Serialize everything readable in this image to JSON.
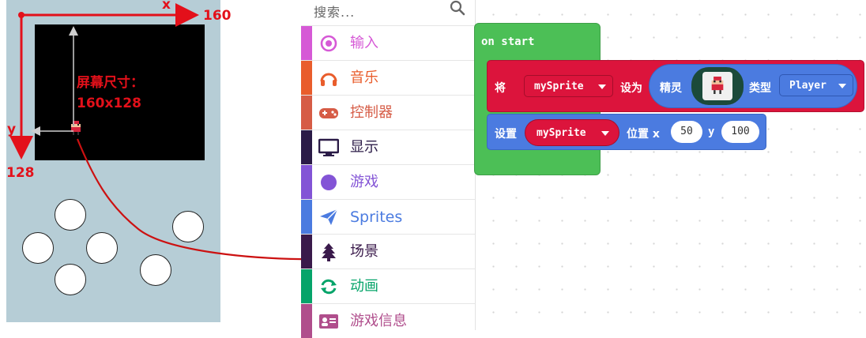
{
  "simulator": {
    "x_axis_label": "x",
    "x_axis_max": "160",
    "y_axis_label": "y",
    "y_axis_max": "128",
    "screen_note_title": "屏幕尺寸：",
    "screen_note_size": "160x128"
  },
  "toolbox": {
    "search_placeholder": "搜索...",
    "categories": [
      {
        "label": "输入",
        "color": "#d659d6",
        "icon": "target-icon"
      },
      {
        "label": "音乐",
        "color": "#e95d2c",
        "icon": "headphones-icon"
      },
      {
        "label": "控制器",
        "color": "#d65c46",
        "icon": "gamepad-icon"
      },
      {
        "label": "显示",
        "color": "#2b1b47",
        "icon": "monitor-icon"
      },
      {
        "label": "游戏",
        "color": "#8354d6",
        "icon": "circle-icon"
      },
      {
        "label": "Sprites",
        "color": "#4b7be0",
        "icon": "paper-plane-icon"
      },
      {
        "label": "场景",
        "color": "#3a1a4b",
        "icon": "tree-icon"
      },
      {
        "label": "动画",
        "color": "#06a46a",
        "icon": "refresh-icon"
      },
      {
        "label": "游戏信息",
        "color": "#b04e8c",
        "icon": "id-card-icon"
      }
    ]
  },
  "workspace": {
    "on_start_label": "on start",
    "set_block": {
      "prefix": "将",
      "variable": "mySprite",
      "set_to": "设为",
      "sprite_label": "精灵",
      "kind_label": "类型",
      "kind_value": "Player"
    },
    "position_block": {
      "prefix": "设置",
      "variable": "mySprite",
      "position_label": "位置 x",
      "x_value": "50",
      "y_label": "y",
      "y_value": "100"
    }
  },
  "colors": {
    "annotation_red": "#e3101a",
    "on_start_green": "#4cbf56",
    "sprite_red": "#dc143c",
    "sprite_blue": "#4b7be0",
    "simulator_bg": "#b6cdd6"
  }
}
